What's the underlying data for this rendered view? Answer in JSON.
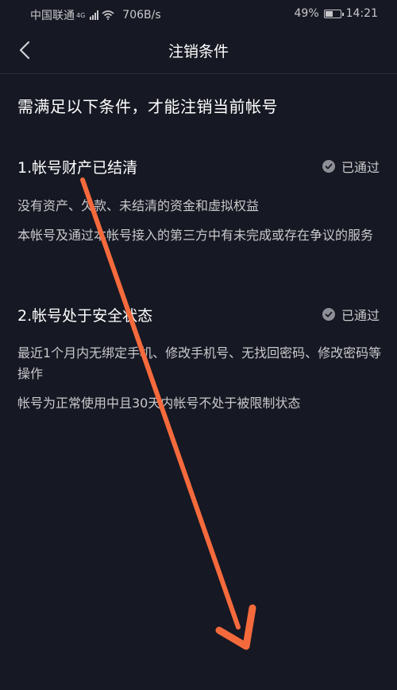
{
  "status_bar": {
    "carrier": "中国联通",
    "network_gen": "4G",
    "speed": "706B/s",
    "battery": "49%",
    "battery_level": 0.49,
    "time": "14:21"
  },
  "nav": {
    "title": "注销条件",
    "back_icon": "chevron-left-icon"
  },
  "heading": "需满足以下条件，才能注销当前帐号",
  "conditions": [
    {
      "title": "1.帐号财产已结清",
      "status": "已通过",
      "lines": [
        "没有资产、欠款、未结清的资金和虚拟权益",
        "本帐号及通过本帐号接入的第三方中有未完成或存在争议的服务"
      ]
    },
    {
      "title": "2.帐号处于安全状态",
      "status": "已通过",
      "lines": [
        "最近1个月内无绑定手机、修改手机号、无找回密码、修改密码等操作",
        "帐号为正常使用中且30天内帐号不处于被限制状态"
      ]
    }
  ],
  "colors": {
    "background": "#161823",
    "arrow": "#f56a3c",
    "check": "#8e8f96"
  }
}
